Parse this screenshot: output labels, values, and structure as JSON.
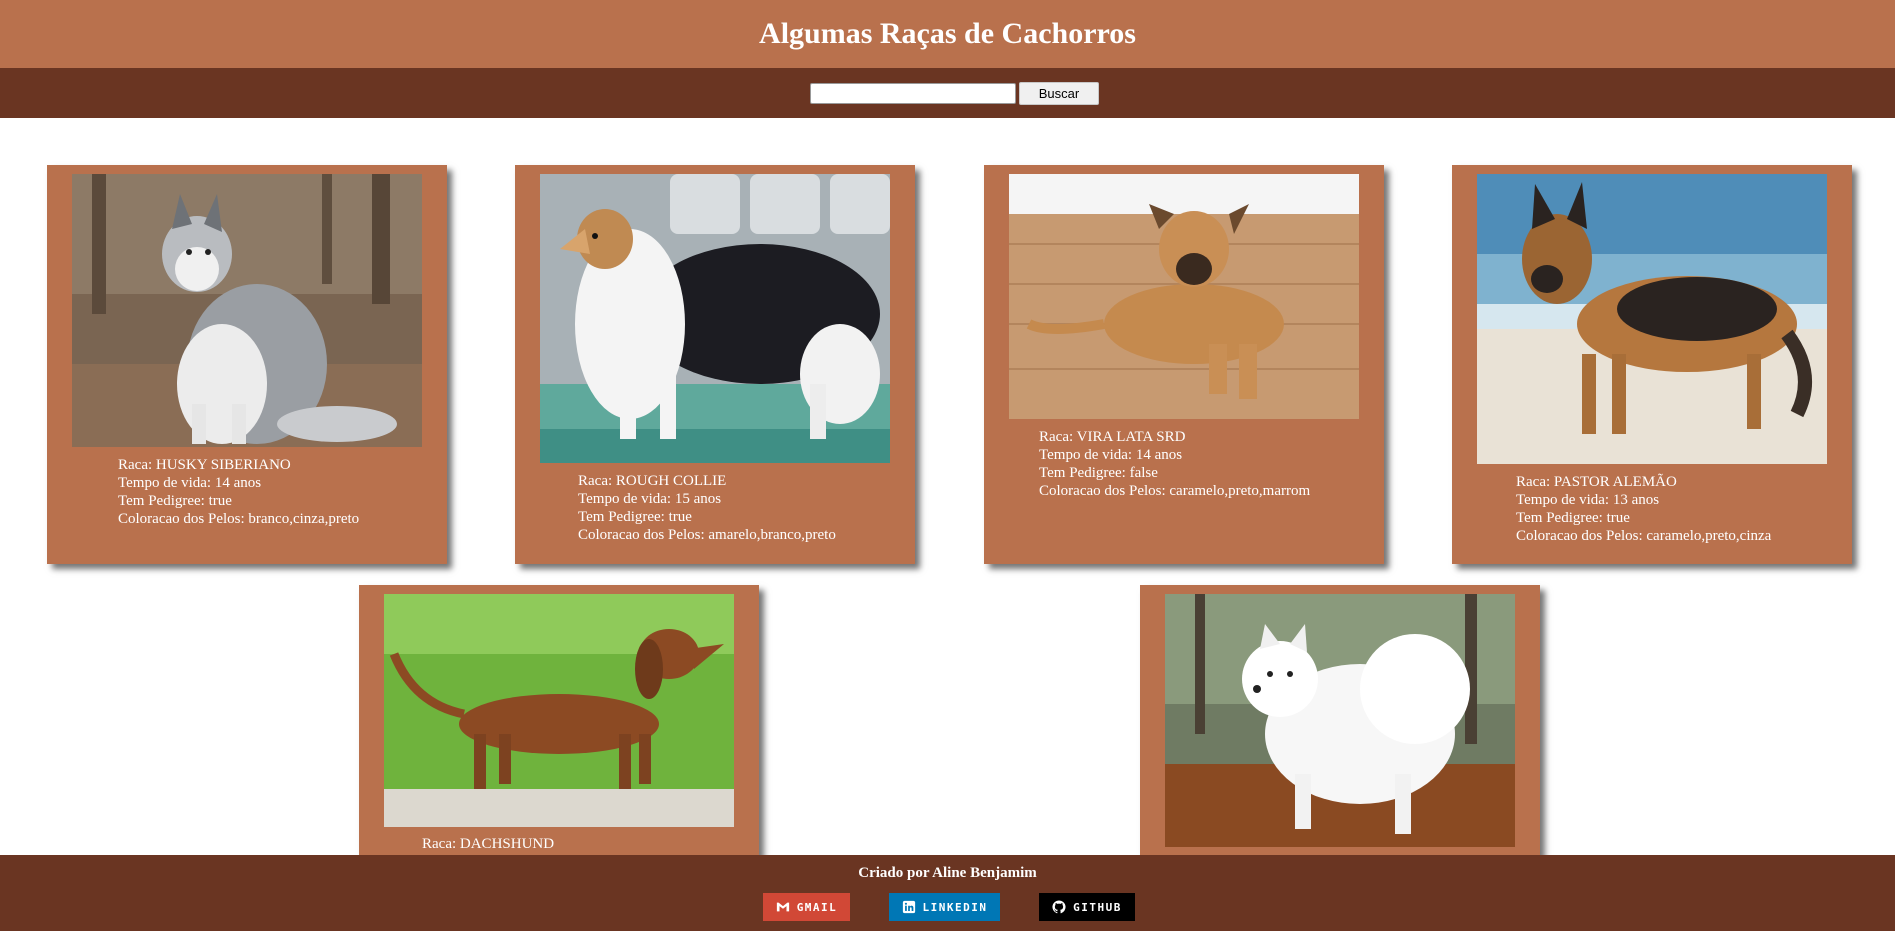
{
  "header": {
    "title": "Algumas Raças de Cachorros"
  },
  "search": {
    "value": "",
    "button_label": "Buscar"
  },
  "dogs": [
    {
      "raca": "Raca: HUSKY SIBERIANO",
      "vida": "Tempo de vida: 14 anos",
      "pedigree": "Tem Pedigree: true",
      "cores": "Coloracao dos Pelos: branco,cinza,preto"
    },
    {
      "raca": "Raca: ROUGH COLLIE",
      "vida": "Tempo de vida: 15 anos",
      "pedigree": "Tem Pedigree: true",
      "cores": "Coloracao dos Pelos: amarelo,branco,preto"
    },
    {
      "raca": "Raca: VIRA LATA SRD",
      "vida": "Tempo de vida: 14 anos",
      "pedigree": "Tem Pedigree: false",
      "cores": "Coloracao dos Pelos: caramelo,preto,marrom"
    },
    {
      "raca": "Raca: PASTOR ALEMÃO",
      "vida": "Tempo de vida: 13 anos",
      "pedigree": "Tem Pedigree: true",
      "cores": "Coloracao dos Pelos: caramelo,preto,cinza"
    },
    {
      "raca": "Raca: DACHSHUND"
    },
    {}
  ],
  "footer": {
    "credit": "Criado por Aline Benjamim",
    "links": [
      {
        "label": "GMAIL",
        "icon": "gmail-icon",
        "color": "#d14836"
      },
      {
        "label": "LINKEDIN",
        "icon": "linkedin-icon",
        "color": "#0077b5"
      },
      {
        "label": "GITHUB",
        "icon": "github-icon",
        "color": "#000000"
      }
    ]
  },
  "colors": {
    "header": "#b9714d",
    "nav": "#6a3522",
    "card": "#b9714d",
    "footer": "#6a3522"
  }
}
